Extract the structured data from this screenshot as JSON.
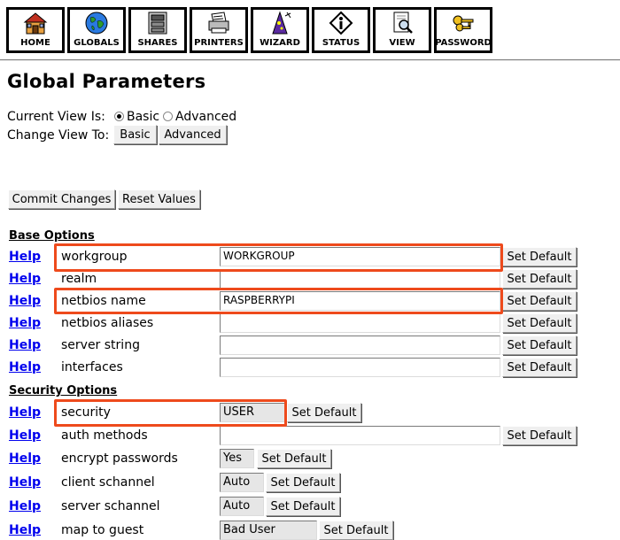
{
  "toolbar": {
    "buttons": [
      {
        "label": "HOME",
        "icon": "home-icon"
      },
      {
        "label": "GLOBALS",
        "icon": "globe-icon"
      },
      {
        "label": "SHARES",
        "icon": "shares-icon"
      },
      {
        "label": "PRINTERS",
        "icon": "printer-icon"
      },
      {
        "label": "WIZARD",
        "icon": "wizard-icon"
      },
      {
        "label": "STATUS",
        "icon": "info-icon"
      },
      {
        "label": "VIEW",
        "icon": "view-icon"
      },
      {
        "label": "PASSWORD",
        "icon": "keys-icon"
      }
    ]
  },
  "page": {
    "title": "Global Parameters",
    "current_view_label": "Current View Is:",
    "current_view_options": [
      "Basic",
      "Advanced"
    ],
    "current_view_selected": "Basic",
    "change_view_label": "Change View To:",
    "change_view_buttons": [
      "Basic",
      "Advanced"
    ],
    "commit_label": "Commit Changes",
    "reset_label": "Reset Values"
  },
  "sections": {
    "base": "Base Options",
    "security": "Security Options"
  },
  "help_label": "Help",
  "set_default_label": "Set Default",
  "params": [
    {
      "name": "workgroup",
      "value": "WORKGROUP"
    },
    {
      "name": "realm",
      "value": ""
    },
    {
      "name": "netbios name",
      "value": "RASPBERRYPI"
    },
    {
      "name": "netbios aliases",
      "value": ""
    },
    {
      "name": "server string",
      "value": ""
    },
    {
      "name": "interfaces",
      "value": ""
    },
    {
      "name": "security",
      "value": "USER"
    },
    {
      "name": "auth methods",
      "value": ""
    },
    {
      "name": "encrypt passwords",
      "value": "Yes"
    },
    {
      "name": "client schannel",
      "value": "Auto"
    },
    {
      "name": "server schannel",
      "value": "Auto"
    },
    {
      "name": "map to guest",
      "value": "Bad User"
    }
  ],
  "colors": {
    "highlight": "#ee4a1c",
    "link": "#0000ee"
  }
}
